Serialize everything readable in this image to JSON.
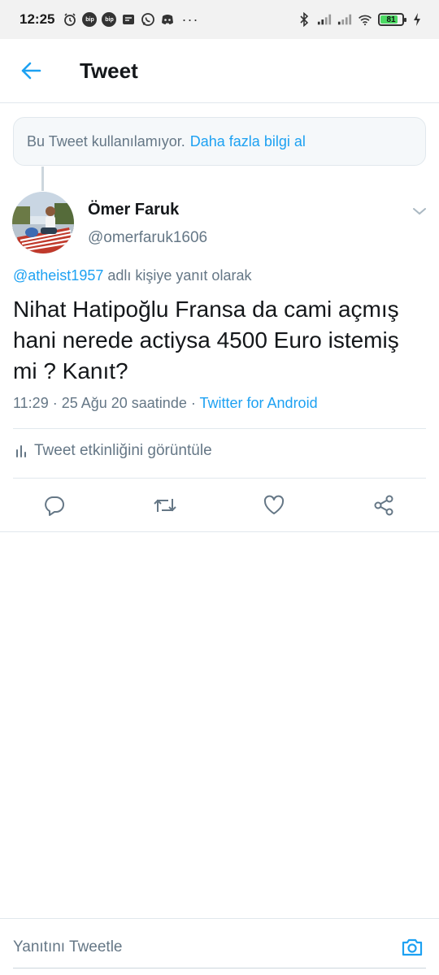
{
  "status_bar": {
    "time": "12:25",
    "bip_label": "bip",
    "more": "···",
    "battery_percent": "81",
    "battery_level": 0.81
  },
  "header": {
    "title": "Tweet"
  },
  "notice": {
    "text": "Bu Tweet kullanılamıyor.",
    "link": "Daha fazla bilgi al"
  },
  "author": {
    "name": "Ömer Faruk",
    "handle": "@omerfaruk1606"
  },
  "reply_to": {
    "mention": "@atheist1957",
    "suffix": "adlı kişiye yanıt olarak"
  },
  "tweet": {
    "text": "Nihat Hatipoğlu Fransa da cami açmış hani nerede actiysa 4500 Euro istemiş mi ? Kanıt?",
    "meta": "11:29 · 25 Ağu 20 saatinde · ",
    "source": "Twitter for Android"
  },
  "activity": {
    "label": "Tweet etkinliğini görüntüle"
  },
  "actions": [
    "comment-icon",
    "retweet-icon",
    "like-icon",
    "share-icon"
  ],
  "reply_bar": {
    "placeholder": "Yanıtını Tweetle"
  },
  "colors": {
    "accent": "#1da1f2",
    "secondary_text": "#657786",
    "border": "#e1e8ed",
    "battery": "#4cd964"
  }
}
